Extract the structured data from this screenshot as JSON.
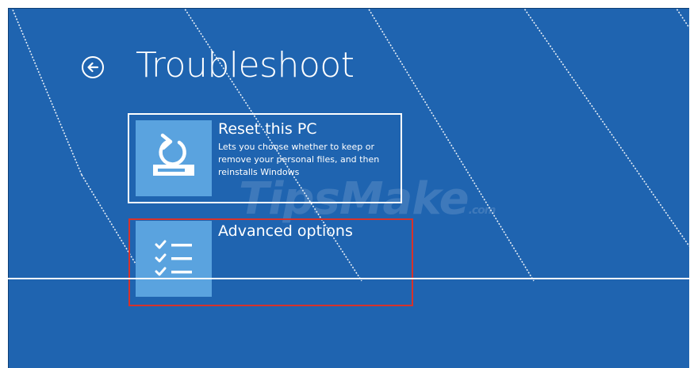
{
  "header": {
    "title": "Troubleshoot",
    "back_icon": "back-arrow-icon"
  },
  "options": [
    {
      "title": "Reset this PC",
      "description_lines": [
        "Lets you choose whether to keep or",
        "remove your personal files, and then",
        "reinstalls Windows"
      ],
      "icon": "reset-pc-icon"
    },
    {
      "title": "Advanced options",
      "icon": "checklist-icon"
    }
  ],
  "watermark": {
    "main": "TipsMake",
    "suffix": ".com"
  },
  "colors": {
    "background": "#1f64b0",
    "tile_icon": "#5aa3df",
    "text": "#ffffff",
    "highlight": "#d8322a"
  }
}
